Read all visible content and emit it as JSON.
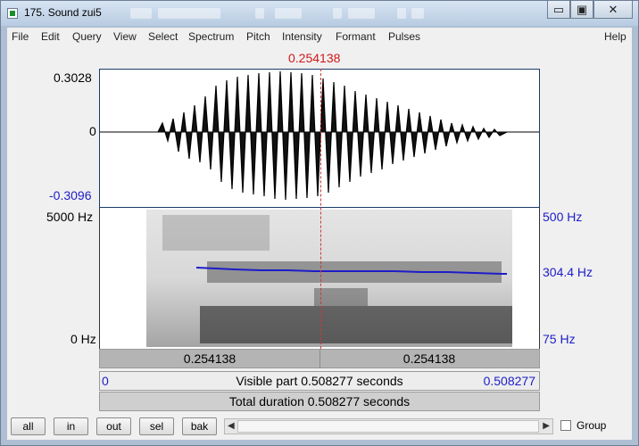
{
  "window": {
    "title": "175. Sound zui5"
  },
  "menu": {
    "items": [
      "File",
      "Edit",
      "Query",
      "View",
      "Select",
      "Spectrum",
      "Pitch",
      "Intensity",
      "Formant",
      "Pulses"
    ],
    "help": "Help"
  },
  "cursor_time": "0.254138",
  "waveform": {
    "y_max": "0.3028",
    "y_zero": "0",
    "y_min": "-0.3096"
  },
  "spectrogram": {
    "freq_top": "5000 Hz",
    "freq_bottom": "0 Hz",
    "pitch_top": "500 Hz",
    "pitch_current": "304.4 Hz",
    "pitch_bottom": "75 Hz"
  },
  "time_bar": {
    "left_segment": "0.254138",
    "right_segment": "0.254138"
  },
  "visible_bar": {
    "start": "0",
    "label": "Visible part 0.508277 seconds",
    "end": "0.508277"
  },
  "total_bar": {
    "label": "Total duration 0.508277 seconds"
  },
  "buttons": {
    "all": "all",
    "in": "in",
    "out": "out",
    "sel": "sel",
    "bak": "bak"
  },
  "group": {
    "label": "Group",
    "checked": false
  },
  "colors": {
    "cursor": "#c83a3a",
    "pitch_line": "#1d1dc8",
    "axis_blue": "#1d1dc8"
  }
}
